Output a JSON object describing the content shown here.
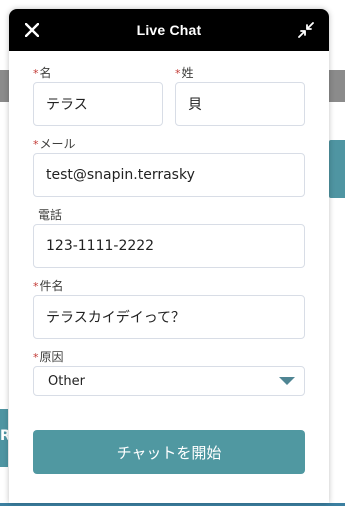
{
  "header": {
    "title": "Live Chat",
    "close_icon": "close-icon",
    "minimize_icon": "minimize-icon"
  },
  "form": {
    "required_marker": "*",
    "first_name": {
      "label": "名",
      "value": "テラス"
    },
    "last_name": {
      "label": "姓",
      "value": "貝"
    },
    "email": {
      "label": "メール",
      "value": "test@snapin.terrasky"
    },
    "phone": {
      "label": "電話",
      "value": "123-1111-2222"
    },
    "subject": {
      "label": "件名",
      "value": "テラスカイデイって？"
    },
    "reason": {
      "label": "原因",
      "selected": "Other"
    },
    "submit_label": "チャットを開始"
  },
  "background": {
    "edge_letter": "R"
  },
  "colors": {
    "header_bg": "#000000",
    "button_bg": "#5098a1",
    "required": "#c23934",
    "caret": "#4f8593"
  }
}
